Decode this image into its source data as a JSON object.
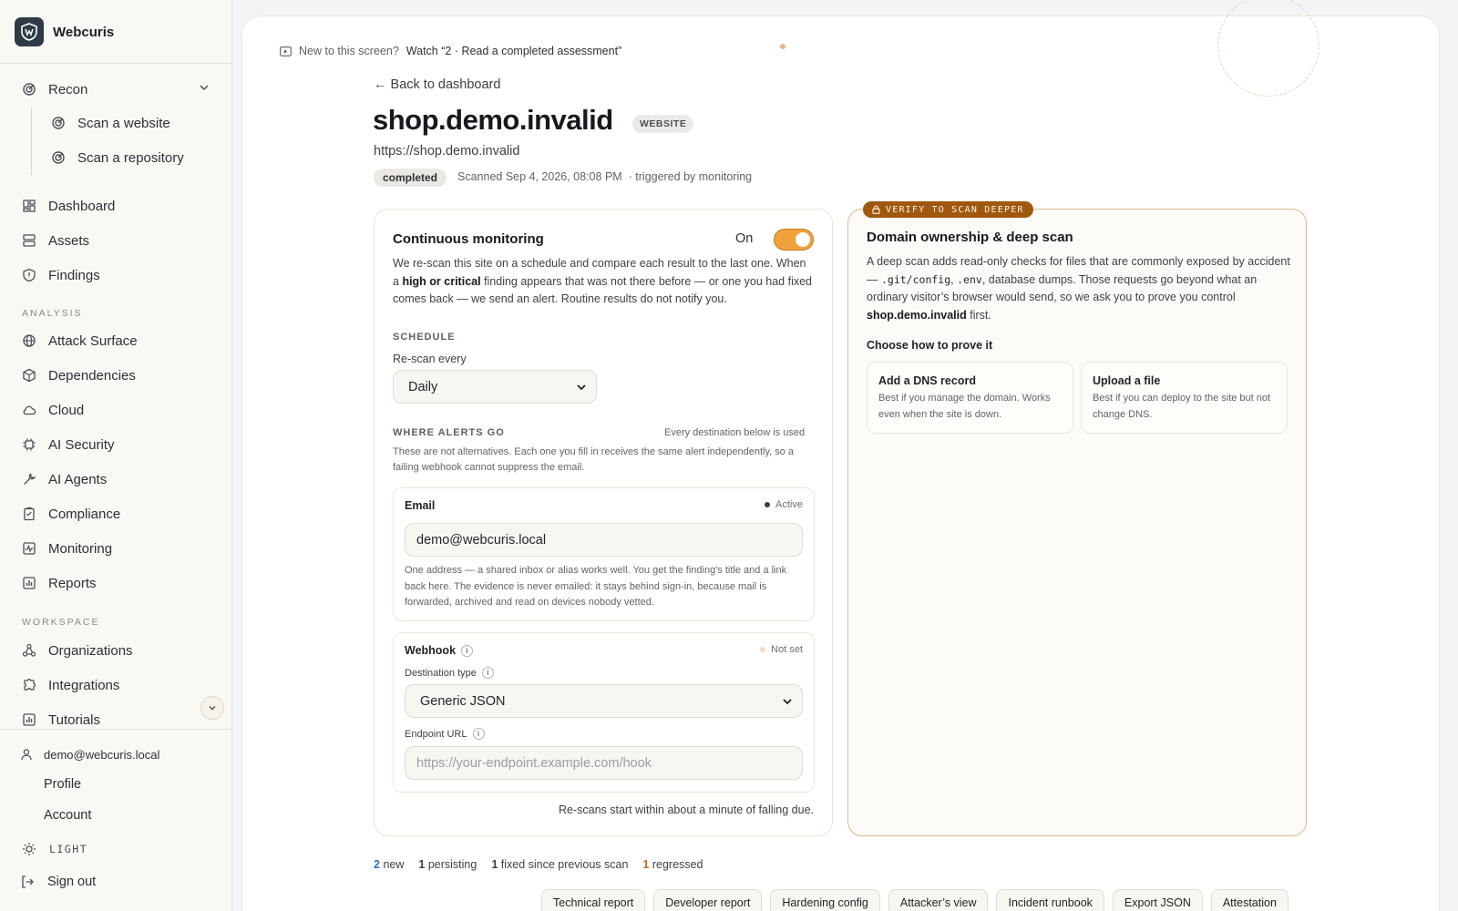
{
  "app": {
    "name": "Webcuris"
  },
  "sidebar": {
    "recon": {
      "label": "Recon",
      "children": [
        {
          "label": "Scan a website"
        },
        {
          "label": "Scan a repository"
        }
      ]
    },
    "main_items": [
      {
        "label": "Dashboard",
        "icon": "dashboard-icon"
      },
      {
        "label": "Assets",
        "icon": "server-icon"
      },
      {
        "label": "Findings",
        "icon": "shield-icon"
      }
    ],
    "analysis_label": "ANALYSIS",
    "analysis_items": [
      {
        "label": "Attack Surface",
        "icon": "globe-icon"
      },
      {
        "label": "Dependencies",
        "icon": "package-icon"
      },
      {
        "label": "Cloud",
        "icon": "cloud-icon"
      },
      {
        "label": "AI Security",
        "icon": "chip-icon"
      },
      {
        "label": "AI Agents",
        "icon": "wrench-icon"
      },
      {
        "label": "Compliance",
        "icon": "clipboard-icon"
      },
      {
        "label": "Monitoring",
        "icon": "pulse-icon"
      },
      {
        "label": "Reports",
        "icon": "bar-chart-icon"
      }
    ],
    "workspace_label": "WORKSPACE",
    "workspace_items": [
      {
        "label": "Organizations",
        "icon": "nodes-icon"
      },
      {
        "label": "Integrations",
        "icon": "puzzle-icon"
      },
      {
        "label": "Tutorials",
        "icon": "bar-chart-icon"
      }
    ],
    "user_email": "demo@webcuris.local",
    "profile_label": "Profile",
    "account_label": "Account",
    "theme_label": "LIGHT",
    "signout_label": "Sign out"
  },
  "hint": {
    "prefix": "New to this screen?",
    "link": "Watch “2 · Read a completed assessment”"
  },
  "header": {
    "back_label": "← Back to dashboard",
    "host": "shop.demo.invalid",
    "kind_badge": "WEBSITE",
    "url": "https://shop.demo.invalid",
    "status": "completed",
    "scanned": "Scanned Sep 4, 2026, 08:08 PM",
    "trigger": "· triggered by monitoring"
  },
  "monitoring": {
    "title": "Continuous monitoring",
    "toggle_label": "On",
    "toggle_on": true,
    "desc_1": "We re-scan this site on a schedule and compare each result to the last one. When a ",
    "desc_bold": "high or critical",
    "desc_2": " finding appears that was not there before — or one you had fixed comes back — we send an alert. Routine results do not notify you.",
    "schedule_label": "SCHEDULE",
    "rescan_label": "Re-scan every",
    "rescan_value": "Daily",
    "alerts_label": "WHERE ALERTS GO",
    "alerts_note": "Every destination below is used",
    "alerts_desc": "These are not alternatives. Each one you fill in receives the same alert independently, so a failing webhook cannot suppress the email.",
    "email": {
      "label": "Email",
      "status": "Active",
      "value": "demo@webcuris.local",
      "help": "One address — a shared inbox or alias works well. You get the finding's title and a link back here. The evidence is never emailed: it stays behind sign-in, because mail is forwarded, archived and read on devices nobody vetted."
    },
    "webhook": {
      "label": "Webhook",
      "status": "Not set",
      "dest_type_label": "Destination type",
      "dest_type_value": "Generic JSON",
      "endpoint_label": "Endpoint URL",
      "endpoint_placeholder": "https://your-endpoint.example.com/hook"
    },
    "rescan_note": "Re-scans start within about a minute of falling due."
  },
  "domain": {
    "tag": "VERIFY TO SCAN DEEPER",
    "title": "Domain ownership & deep scan",
    "desc_1": "A deep scan adds read-only checks for files that are commonly exposed by accident — ",
    "code_1": ".git/config",
    "sep": ", ",
    "code_2": ".env",
    "desc_2": ", database dumps. Those requests go beyond what an ordinary visitor’s browser would send, so we ask you to prove you control ",
    "desc_bold": "shop.demo.invalid",
    "desc_3": " first.",
    "choose_label": "Choose how to prove it",
    "options": [
      {
        "title": "Add a DNS record",
        "desc": "Best if you manage the domain. Works even when the site is down."
      },
      {
        "title": "Upload a file",
        "desc": "Best if you can deploy to the site but not change DNS."
      }
    ]
  },
  "diff": {
    "new_count": "2",
    "new_label": "new",
    "persisting_count": "1",
    "persisting_label": "persisting",
    "fixed_count": "1",
    "fixed_label": "fixed since previous scan",
    "regressed_count": "1",
    "regressed_label": "regressed"
  },
  "reports": [
    "Technical report",
    "Developer report",
    "Hardening config",
    "Attacker’s view",
    "Incident runbook",
    "Export JSON",
    "Attestation"
  ],
  "colors": {
    "accent": "#f0a13b",
    "verify_tag": "#a0580f",
    "new": "#2f6fd1",
    "regressed": "#c9661a"
  }
}
